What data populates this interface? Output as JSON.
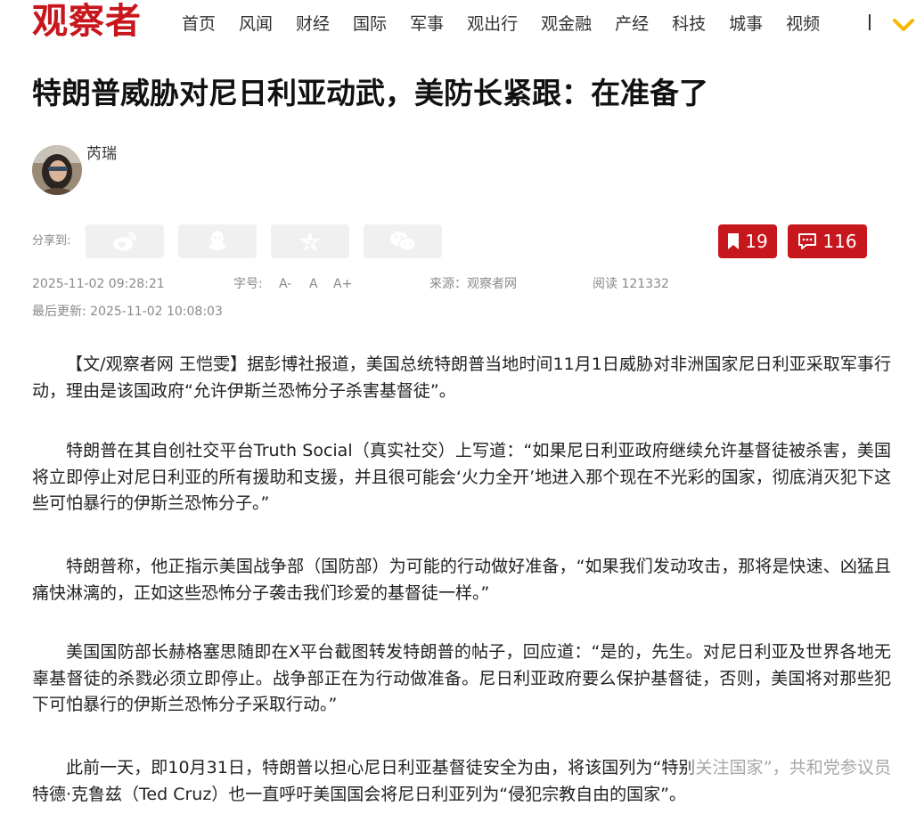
{
  "site": {
    "logo": "观察者"
  },
  "nav": [
    "首页",
    "风闻",
    "财经",
    "国际",
    "军事",
    "观出行",
    "观金融",
    "产经",
    "科技",
    "城事",
    "视频"
  ],
  "article": {
    "title": "特朗普威胁对尼日利亚动武，美防长紧跟：在准备了",
    "author": "芮瑞",
    "share_label": "分享到:",
    "collect_count": "19",
    "comment_count": "116",
    "publish_time": "2025-11-02 09:28:21",
    "font_size_label": "字号:",
    "font_small": "A-",
    "font_normal": "A",
    "font_large": "A+",
    "source": "来源：观察者网",
    "reads": "阅读 121332",
    "last_updated": "最后更新: 2025-11-02 10:08:03",
    "paragraphs": [
      "【文/观察者网 王恺雯】据彭博社报道，美国总统特朗普当地时间11月1日威胁对非洲国家尼日利亚采取军事行动，理由是该国政府“允许伊斯兰恐怖分子杀害基督徒”。",
      "特朗普在其自创社交平台Truth Social（真实社交）上写道：“如果尼日利亚政府继续允许基督徒被杀害，美国将立即停止对尼日利亚的所有援助和支援，并且很可能会‘火力全开’地进入那个现在不光彩的国家，彻底消灭犯下这些可怕暴行的伊斯兰恐怖分子。”",
      "特朗普称，他正指示美国战争部（国防部）为可能的行动做好准备，“如果我们发动攻击，那将是快速、凶猛且痛快淋漓的，正如这些恐怖分子袭击我们珍爱的基督徒一样。”",
      "美国国防部长赫格塞思随即在X平台截图转发特朗普的帖子，回应道：“是的，先生。对尼日利亚及世界各地无辜基督徒的杀戮必须立即停止。战争部正在为行动做准备。尼日利亚政府要么保护基督徒，否则，美国将对那些犯下可怕暴行的伊斯兰恐怖分子采取行动。”",
      "此前一天，即10月31日，特朗普以担心尼日利亚基督徒安全为由，将该国列为“特别关注国家”，共和党参议员特德·克鲁兹（Ted Cruz）也一直呼吁美国国会将尼日利亚列为“侵犯宗教自由的国家”。"
    ]
  },
  "colors": {
    "brand": "#c8161d",
    "meta": "#8a8a8a",
    "share_bg": "#f0f0f0",
    "nav_more": "#f5b800"
  },
  "icons": [
    "weibo-icon",
    "qq-icon",
    "qzone-star-icon",
    "wechat-icon",
    "bookmark-icon",
    "comment-icon",
    "chevron-down-icon"
  ]
}
